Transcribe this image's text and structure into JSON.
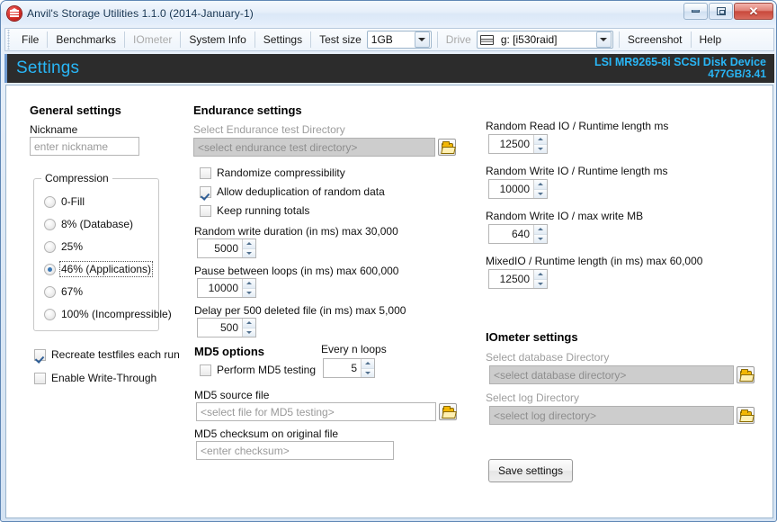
{
  "window": {
    "title": "Anvil's Storage Utilities 1.1.0 (2014-January-1)",
    "icon": "anvil-app-icon",
    "minimize_label": "–",
    "maximize_label": "□",
    "close_label": "✕"
  },
  "toolbar": {
    "menus": [
      {
        "label": "File",
        "disabled": false
      },
      {
        "label": "Benchmarks",
        "disabled": false
      },
      {
        "label": "IOmeter",
        "disabled": true
      },
      {
        "label": "System Info",
        "disabled": false
      },
      {
        "label": "Settings",
        "disabled": false
      }
    ],
    "test_size_label": "Test size",
    "test_size_value": "1GB",
    "drive_label": "Drive",
    "drive_value": "g: [i530raid]",
    "drive_icon": "drive-icon",
    "screenshot_label": "Screenshot",
    "help_label": "Help"
  },
  "header": {
    "page_title": "Settings",
    "device_name": "LSI MR9265-8i SCSI Disk Device",
    "device_capacity": "477GB/3.41",
    "accent_color": "#29b6f6",
    "background_color": "#2c2c2c"
  },
  "general": {
    "section_title": "General settings",
    "nickname_label": "Nickname",
    "nickname_placeholder": "enter nickname",
    "nickname_value": "",
    "compression": {
      "group_title": "Compression",
      "selected_index": 3,
      "options": [
        {
          "label": "0-Fill",
          "checked": false
        },
        {
          "label": "8% (Database)",
          "checked": false
        },
        {
          "label": "25%",
          "checked": false
        },
        {
          "label": "46% (Applications)",
          "checked": true
        },
        {
          "label": "67%",
          "checked": false
        },
        {
          "label": "100% (Incompressible)",
          "checked": false
        }
      ]
    },
    "checkboxes": [
      {
        "label": "Recreate testfiles each run",
        "checked": true
      },
      {
        "label": "Enable Write-Through",
        "checked": false
      }
    ]
  },
  "endurance": {
    "section_title": "Endurance settings",
    "dir_label": "Select Endurance test Directory",
    "dir_placeholder": "<select endurance test directory>",
    "dir_disabled": true,
    "browse_icon": "folder-open-icon",
    "checkboxes": [
      {
        "label": "Randomize compressibility",
        "checked": false
      },
      {
        "label": "Allow deduplication of random data",
        "checked": true
      },
      {
        "label": "Keep running totals",
        "checked": false
      }
    ],
    "fields": [
      {
        "label": "Random write duration (in ms) max 30,000",
        "value": "5000"
      },
      {
        "label": "Pause between loops (in ms) max 600,000",
        "value": "10000"
      },
      {
        "label": "Delay per 500 deleted file (in ms) max 5,000",
        "value": "500"
      }
    ]
  },
  "md5": {
    "section_title": "MD5 options",
    "perform_label": "Perform MD5 testing",
    "perform_checked": false,
    "every_n_loops_label": "Every n loops",
    "every_n_loops_value": "5",
    "source_file_label": "MD5 source file",
    "source_file_placeholder": "<select file for MD5 testing>",
    "source_browse_icon": "folder-open-icon",
    "checksum_label": "MD5 checksum on original file",
    "checksum_placeholder": "<enter checksum>"
  },
  "io": {
    "fields": [
      {
        "label": "Random Read IO / Runtime length ms",
        "value": "12500"
      },
      {
        "label": "Random Write IO / Runtime length ms",
        "value": "10000"
      },
      {
        "label": "Random Write IO / max write MB",
        "value": "640"
      },
      {
        "label": "MixedIO / Runtime length (in ms) max 60,000",
        "value": "12500"
      }
    ]
  },
  "iometer": {
    "section_title": "IOmeter settings",
    "db_label": "Select database Directory",
    "db_placeholder": "<select database directory>",
    "log_label": "Select log Directory",
    "log_placeholder": "<select log directory>",
    "browse_icon": "folder-open-icon"
  },
  "actions": {
    "save_label": "Save settings"
  }
}
